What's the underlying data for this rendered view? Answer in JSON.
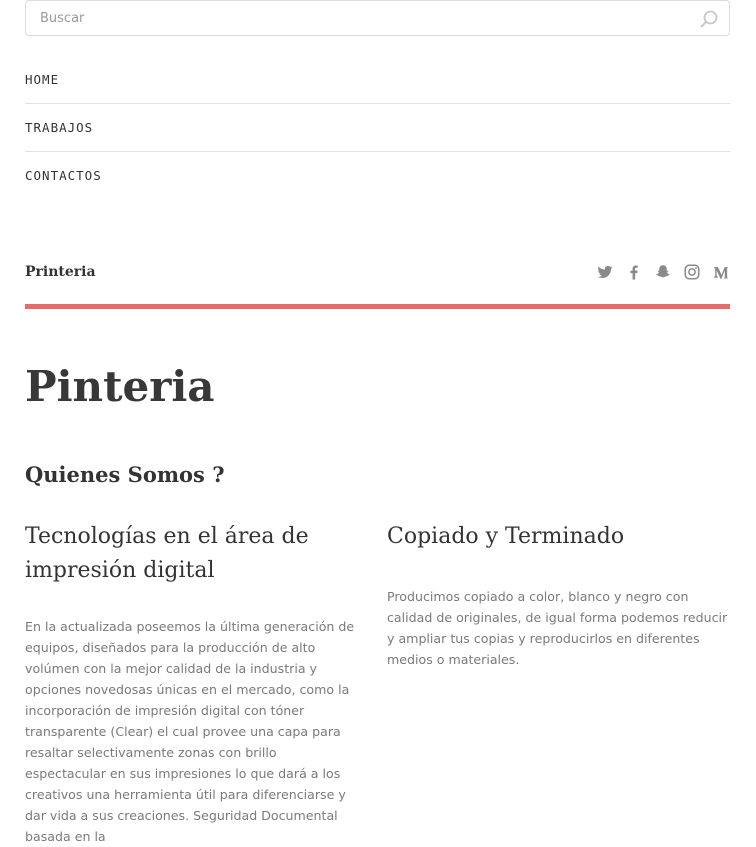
{
  "search": {
    "placeholder": "Buscar"
  },
  "nav": {
    "items": [
      "HOME",
      "TRABAJOS",
      "CONTACTOS"
    ]
  },
  "site": {
    "title": "Printeria"
  },
  "social": {
    "icons": [
      "twitter-icon",
      "facebook-icon",
      "snapchat-icon",
      "instagram-icon",
      "medium-icon"
    ]
  },
  "colors": {
    "accent_bar": "#e86b6b",
    "body_text": "#7a7a7a",
    "heading": "#333333"
  },
  "page": {
    "title": "Pinteria",
    "subtitle": "Quienes Somos ?",
    "columns": [
      {
        "heading": "Tecnologías en el área de impresión digital",
        "body": "En la actualizada poseemos la última generación de equipos, diseñados para la producción de alto volúmen con la mejor calidad de la industria y opciones novedosas únicas en el mercado, como la incorporación de impresión digital con tóner transparente (Clear) el cual provee una capa para resaltar selectivamente zonas con brillo espectacular en sus impresiones lo que dará a los creativos una herramienta útil para diferenciarse y dar vida a sus creaciones. Seguridad Documental basada en la"
      },
      {
        "heading": "Copiado y Terminado",
        "body": "Producimos copiado a color, blanco y negro con calidad de originales, de igual forma podemos reducir y ampliar tus copias y reproducirlos en diferentes medios o materiales."
      }
    ]
  }
}
